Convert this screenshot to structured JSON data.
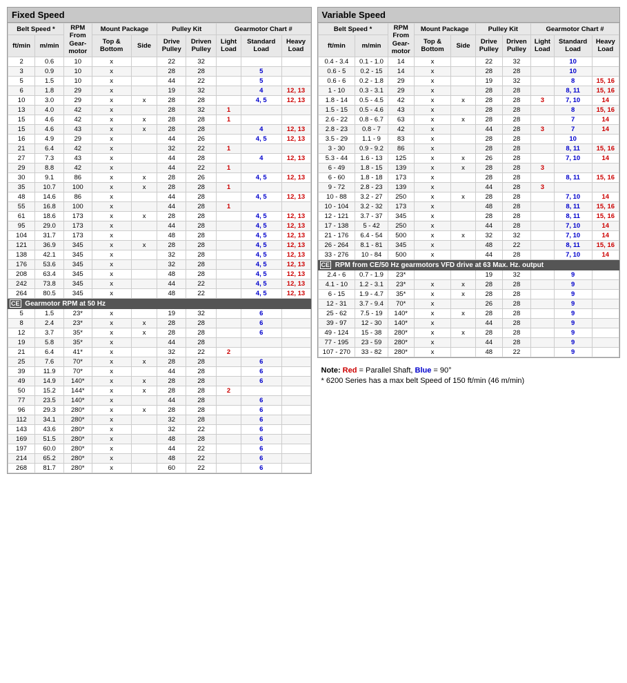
{
  "fixedSpeed": {
    "title": "Fixed Speed",
    "headers": {
      "beltSpeed": "Belt Speed *",
      "ftmin": "ft/min",
      "mmin": "m/min",
      "rpmFromGearmotor": "RPM From Gearmotor",
      "mountPackage": "Mount Package",
      "topBottom": "Top & Bottom",
      "side": "Side",
      "pulleyKit": "Pulley Kit",
      "drivePulley": "Drive Pulley",
      "drivenPulley": "Driven Pulley",
      "gearmotorChart": "Gearmotor Chart #",
      "lightLoad": "Light Load",
      "standardLoad": "Standard Load",
      "heavyLoad": "Heavy Load"
    },
    "rows": [
      [
        "2",
        "0.6",
        "10",
        "x",
        "",
        "22",
        "32",
        "",
        "",
        ""
      ],
      [
        "3",
        "0.9",
        "10",
        "x",
        "",
        "28",
        "28",
        "",
        "5",
        ""
      ],
      [
        "5",
        "1.5",
        "10",
        "x",
        "",
        "44",
        "22",
        "",
        "5",
        ""
      ],
      [
        "6",
        "1.8",
        "29",
        "x",
        "",
        "19",
        "32",
        "",
        "4",
        "12, 13"
      ],
      [
        "10",
        "3.0",
        "29",
        "x",
        "x",
        "28",
        "28",
        "",
        "4, 5",
        "12, 13"
      ],
      [
        "13",
        "4.0",
        "42",
        "x",
        "",
        "28",
        "32",
        "1",
        "",
        ""
      ],
      [
        "15",
        "4.6",
        "42",
        "x",
        "x",
        "28",
        "28",
        "1",
        "",
        ""
      ],
      [
        "15",
        "4.6",
        "43",
        "x",
        "x",
        "28",
        "28",
        "",
        "4",
        "12, 13"
      ],
      [
        "16",
        "4.9",
        "29",
        "x",
        "",
        "44",
        "26",
        "",
        "4, 5",
        "12, 13"
      ],
      [
        "21",
        "6.4",
        "42",
        "x",
        "",
        "32",
        "22",
        "1",
        "",
        ""
      ],
      [
        "27",
        "7.3",
        "43",
        "x",
        "",
        "44",
        "28",
        "",
        "4",
        "12, 13"
      ],
      [
        "29",
        "8.8",
        "42",
        "x",
        "",
        "44",
        "22",
        "1",
        "",
        ""
      ],
      [
        "30",
        "9.1",
        "86",
        "x",
        "x",
        "28",
        "26",
        "",
        "4, 5",
        "12, 13"
      ],
      [
        "35",
        "10.7",
        "100",
        "x",
        "x",
        "28",
        "28",
        "1",
        "",
        ""
      ],
      [
        "48",
        "14.6",
        "86",
        "x",
        "",
        "44",
        "28",
        "",
        "4, 5",
        "12, 13"
      ],
      [
        "55",
        "16.8",
        "100",
        "x",
        "",
        "44",
        "28",
        "1",
        "",
        ""
      ],
      [
        "61",
        "18.6",
        "173",
        "x",
        "x",
        "28",
        "28",
        "",
        "4, 5",
        "12, 13"
      ],
      [
        "95",
        "29.0",
        "173",
        "x",
        "",
        "44",
        "28",
        "",
        "4, 5",
        "12, 13"
      ],
      [
        "104",
        "31.7",
        "173",
        "x",
        "",
        "48",
        "28",
        "",
        "4, 5",
        "12, 13"
      ],
      [
        "121",
        "36.9",
        "345",
        "x",
        "x",
        "28",
        "28",
        "",
        "4, 5",
        "12, 13"
      ],
      [
        "138",
        "42.1",
        "345",
        "x",
        "",
        "32",
        "28",
        "",
        "4, 5",
        "12, 13"
      ],
      [
        "176",
        "53.6",
        "345",
        "x",
        "",
        "32",
        "28",
        "",
        "4, 5",
        "12, 13"
      ],
      [
        "208",
        "63.4",
        "345",
        "x",
        "",
        "48",
        "28",
        "",
        "4, 5",
        "12, 13"
      ],
      [
        "242",
        "73.8",
        "345",
        "x",
        "",
        "44",
        "22",
        "",
        "4, 5",
        "12, 13"
      ],
      [
        "264",
        "80.5",
        "345",
        "x",
        "",
        "48",
        "22",
        "",
        "4, 5",
        "12, 13"
      ]
    ],
    "ceRows": [
      [
        "5",
        "1.5",
        "23*",
        "x",
        "",
        "19",
        "32",
        "",
        "6",
        ""
      ],
      [
        "8",
        "2.4",
        "23*",
        "x",
        "x",
        "28",
        "28",
        "",
        "6",
        ""
      ],
      [
        "12",
        "3.7",
        "35*",
        "x",
        "x",
        "28",
        "28",
        "",
        "6",
        ""
      ],
      [
        "19",
        "5.8",
        "35*",
        "x",
        "",
        "44",
        "28",
        "",
        "",
        ""
      ],
      [
        "21",
        "6.4",
        "41*",
        "x",
        "",
        "32",
        "22",
        "2",
        "",
        ""
      ],
      [
        "25",
        "7.6",
        "70*",
        "x",
        "x",
        "28",
        "28",
        "",
        "6",
        ""
      ],
      [
        "39",
        "11.9",
        "70*",
        "x",
        "",
        "44",
        "28",
        "",
        "6",
        ""
      ],
      [
        "49",
        "14.9",
        "140*",
        "x",
        "x",
        "28",
        "28",
        "",
        "6",
        ""
      ],
      [
        "50",
        "15.2",
        "144*",
        "x",
        "x",
        "28",
        "28",
        "2",
        "",
        ""
      ],
      [
        "77",
        "23.5",
        "140*",
        "x",
        "",
        "44",
        "28",
        "",
        "6",
        ""
      ],
      [
        "96",
        "29.3",
        "280*",
        "x",
        "x",
        "28",
        "28",
        "",
        "6",
        ""
      ],
      [
        "112",
        "34.1",
        "280*",
        "x",
        "",
        "32",
        "28",
        "",
        "6",
        ""
      ],
      [
        "143",
        "43.6",
        "280*",
        "x",
        "",
        "32",
        "22",
        "",
        "6",
        ""
      ],
      [
        "169",
        "51.5",
        "280*",
        "x",
        "",
        "48",
        "28",
        "",
        "6",
        ""
      ],
      [
        "197",
        "60.0",
        "280*",
        "x",
        "",
        "44",
        "22",
        "",
        "6",
        ""
      ],
      [
        "214",
        "65.2",
        "280*",
        "x",
        "",
        "48",
        "22",
        "",
        "6",
        ""
      ],
      [
        "268",
        "81.7",
        "280*",
        "x",
        "",
        "60",
        "22",
        "",
        "6",
        ""
      ]
    ]
  },
  "variableSpeed": {
    "title": "Variable Speed",
    "rows": [
      [
        "0.4 - 3.4",
        "0.1 - 1.0",
        "14",
        "x",
        "",
        "22",
        "32",
        "",
        "10",
        ""
      ],
      [
        "0.6 - 5",
        "0.2 - 15",
        "14",
        "x",
        "",
        "28",
        "28",
        "",
        "10",
        ""
      ],
      [
        "0.6 - 6",
        "0.2 - 1.8",
        "29",
        "x",
        "",
        "19",
        "32",
        "",
        "8",
        "15, 16"
      ],
      [
        "1 - 10",
        "0.3 - 3.1",
        "29",
        "x",
        "",
        "28",
        "28",
        "",
        "8, 11",
        "15, 16"
      ],
      [
        "1.8 - 14",
        "0.5 - 4.5",
        "42",
        "x",
        "x",
        "28",
        "28",
        "3",
        "7, 10",
        "14"
      ],
      [
        "1.5 - 15",
        "0.5 - 4.6",
        "43",
        "x",
        "",
        "28",
        "28",
        "",
        "8",
        "15, 16"
      ],
      [
        "2.6 - 22",
        "0.8 - 6.7",
        "63",
        "x",
        "x",
        "28",
        "28",
        "",
        "7",
        "14"
      ],
      [
        "2.8 - 23",
        "0.8 - 7",
        "42",
        "x",
        "",
        "44",
        "28",
        "3",
        "7",
        "14"
      ],
      [
        "3.5 - 29",
        "1.1 - 9",
        "83",
        "x",
        "",
        "28",
        "28",
        "",
        "10",
        ""
      ],
      [
        "3 - 30",
        "0.9 - 9.2",
        "86",
        "x",
        "",
        "28",
        "28",
        "",
        "8, 11",
        "15, 16"
      ],
      [
        "5.3 - 44",
        "1.6 - 13",
        "125",
        "x",
        "x",
        "26",
        "28",
        "",
        "7, 10",
        "14"
      ],
      [
        "6 - 49",
        "1.8 - 15",
        "139",
        "x",
        "x",
        "28",
        "28",
        "3",
        "",
        ""
      ],
      [
        "6 - 60",
        "1.8 - 18",
        "173",
        "x",
        "",
        "28",
        "28",
        "",
        "8, 11",
        "15, 16"
      ],
      [
        "9 - 72",
        "2.8 - 23",
        "139",
        "x",
        "",
        "44",
        "28",
        "3",
        "",
        ""
      ],
      [
        "10 - 88",
        "3.2 - 27",
        "250",
        "x",
        "x",
        "28",
        "28",
        "",
        "7, 10",
        "14"
      ],
      [
        "10 - 104",
        "3.2 - 32",
        "173",
        "x",
        "",
        "48",
        "28",
        "",
        "8, 11",
        "15, 16"
      ],
      [
        "12 - 121",
        "3.7 - 37",
        "345",
        "x",
        "",
        "28",
        "28",
        "",
        "8, 11",
        "15, 16"
      ],
      [
        "17 - 138",
        "5 - 42",
        "250",
        "x",
        "",
        "44",
        "28",
        "",
        "7, 10",
        "14"
      ],
      [
        "21 - 176",
        "6.4 - 54",
        "500",
        "x",
        "x",
        "32",
        "32",
        "",
        "7, 10",
        "14"
      ],
      [
        "26 - 264",
        "8.1 - 81",
        "345",
        "x",
        "",
        "48",
        "22",
        "",
        "8, 11",
        "15, 16"
      ],
      [
        "33 - 276",
        "10 - 84",
        "500",
        "x",
        "",
        "44",
        "28",
        "",
        "7, 10",
        "14"
      ]
    ],
    "ceRows": [
      [
        "2.4 - 6",
        "0.7 - 1.9",
        "23*",
        "",
        "",
        "19",
        "32",
        "",
        "9",
        ""
      ],
      [
        "4.1 - 10",
        "1.2 - 3.1",
        "23*",
        "x",
        "x",
        "28",
        "28",
        "",
        "9",
        ""
      ],
      [
        "6 - 15",
        "1.9 - 4.7",
        "35*",
        "x",
        "x",
        "28",
        "28",
        "",
        "9",
        ""
      ],
      [
        "12 - 31",
        "3.7 - 9.4",
        "70*",
        "x",
        "",
        "26",
        "28",
        "",
        "9",
        ""
      ],
      [
        "25 - 62",
        "7.5 - 19",
        "140*",
        "x",
        "x",
        "28",
        "28",
        "",
        "9",
        ""
      ],
      [
        "39 - 97",
        "12 - 30",
        "140*",
        "x",
        "",
        "44",
        "28",
        "",
        "9",
        ""
      ],
      [
        "49 - 124",
        "15 - 38",
        "280*",
        "x",
        "x",
        "28",
        "28",
        "",
        "9",
        ""
      ],
      [
        "77 - 195",
        "23 - 59",
        "280*",
        "x",
        "",
        "44",
        "28",
        "",
        "9",
        ""
      ],
      [
        "107 - 270",
        "33 - 82",
        "280*",
        "x",
        "",
        "48",
        "22",
        "",
        "9",
        ""
      ]
    ]
  },
  "note": {
    "line1": "Note: Red = Parallel Shaft, Blue = 90°",
    "line2": "* 6200 Series has a max belt Speed of 150 ft/min (46 m/min)"
  }
}
